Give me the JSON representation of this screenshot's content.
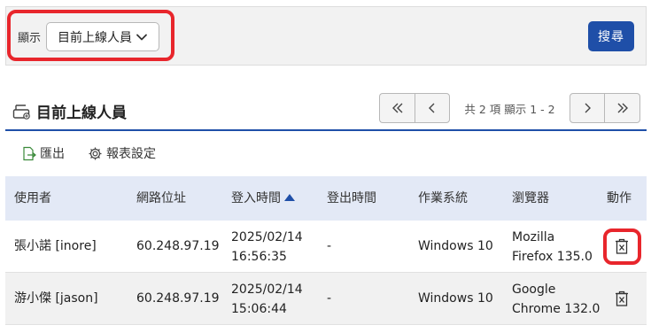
{
  "filter": {
    "label": "顯示",
    "select_value": "目前上線人員",
    "search_label": "搜尋"
  },
  "section": {
    "title": "目前上線人員"
  },
  "pager": {
    "info": "共 2 項 顯示 1 - 2"
  },
  "toolbar": {
    "export_label": "匯出",
    "settings_label": "報表設定"
  },
  "table": {
    "headers": [
      "使用者",
      "網路位址",
      "登入時間",
      "登出時間",
      "作業系統",
      "瀏覽器",
      "動作"
    ],
    "rows": [
      {
        "user": "張小諾 [inore]",
        "ip": "60.248.97.19",
        "login_date": "2025/02/14",
        "login_time": "16:56:35",
        "logout": "-",
        "os": "Windows 10",
        "browser_l1": "Mozilla",
        "browser_l2": "Firefox 135.0"
      },
      {
        "user": "游小傑 [jason]",
        "ip": "60.248.97.19",
        "login_date": "2025/02/14",
        "login_time": "15:06:44",
        "logout": "-",
        "os": "Windows 10",
        "browser_l1": "Google",
        "browser_l2": "Chrome 132.0"
      }
    ]
  },
  "colors": {
    "accent": "#1f4fa8",
    "highlight": "#e8262c",
    "header_bg": "#e3e9f6"
  },
  "icons": {
    "select_chevron": "chevron-down-icon",
    "section": "printer-icon",
    "first": "double-chevron-left-icon",
    "prev": "chevron-left-icon",
    "next": "chevron-right-icon",
    "last": "double-chevron-right-icon",
    "export": "export-file-icon",
    "settings": "gear-icon",
    "sort": "sort-up-icon",
    "delete": "delete-icon"
  }
}
